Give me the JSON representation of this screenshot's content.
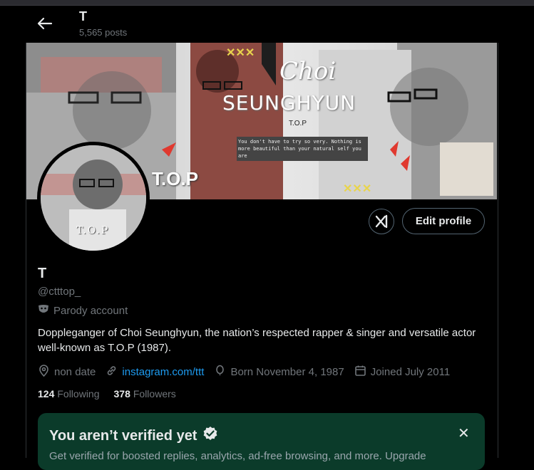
{
  "header": {
    "name": "T",
    "posts": "5,565 posts"
  },
  "banner": {
    "title_line1": "Choi",
    "title_line2": "SEUNGHYUN",
    "subtitle": "T.O.P",
    "quote": "You don't have to try so very. Nothing is more beautiful than your natural self you are",
    "marks": "✕✕✕",
    "tag": "T.O.P"
  },
  "avatar": {
    "tag": "T.O.P"
  },
  "actions": {
    "edit_label": "Edit profile"
  },
  "profile": {
    "name": "T",
    "handle": "@ctttop_",
    "parody_label": "Parody account",
    "bio": "Doppleganger of Choi Seunghyun, the nation’s respected rapper & singer and versatile actor well-known as T.O.P (1987).",
    "location": "non date",
    "website": "instagram.com/ttt",
    "born": "Born November 4, 1987",
    "joined": "Joined July 2011"
  },
  "stats": {
    "following_count": "124",
    "following_label": "Following",
    "followers_count": "378",
    "followers_label": "Followers"
  },
  "verify_card": {
    "title": "You aren’t verified yet",
    "text": "Get verified for boosted replies, analytics, ad-free browsing, and more. Upgrade",
    "close": "✕"
  }
}
